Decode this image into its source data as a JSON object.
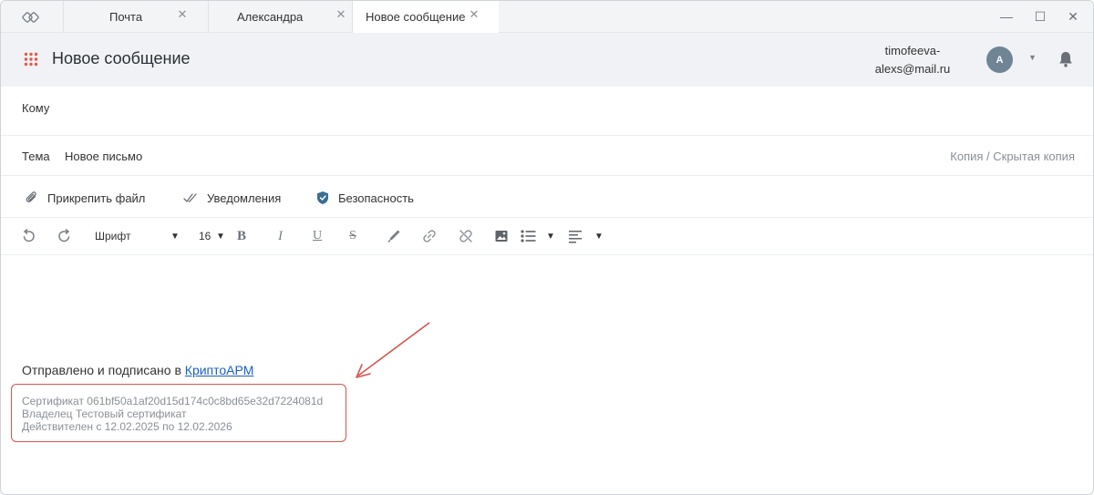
{
  "tabs": [
    {
      "label": "Почта"
    },
    {
      "label": "Александра"
    },
    {
      "label": "Новое сообщение",
      "active": true
    }
  ],
  "window_controls": {
    "minimize": "—",
    "maximize": "☐",
    "close": "✕"
  },
  "header": {
    "title": "Новое сообщение",
    "user_email_line1": "timofeeva-",
    "user_email_line2": "alexs@mail.ru",
    "avatar_initial": "A"
  },
  "form": {
    "to_label": "Кому",
    "subject_label": "Тема",
    "subject_value": "Новое письмо",
    "cc_link": "Копия / Скрытая копия"
  },
  "actions": {
    "attach": "Прикрепить файл",
    "notifications": "Уведомления",
    "security": "Безопасность"
  },
  "toolbar": {
    "font": "Шрифт",
    "font_size": "16"
  },
  "body": {
    "signed_prefix": "Отправлено и подписано в ",
    "signed_link": "КриптоАРМ",
    "certificate": "Сертификат 061bf50a1af20d15d174c0c8bd65e32d7224081d",
    "owner": "Владелец Тестовый сертификат",
    "validity": "Действителен с 12.02.2025 по 12.02.2026"
  },
  "colors": {
    "accent_red": "#d9534f",
    "link_blue": "#1a5fc4",
    "avatar": "#6f8596",
    "grid_icon": "#e25a4a"
  }
}
